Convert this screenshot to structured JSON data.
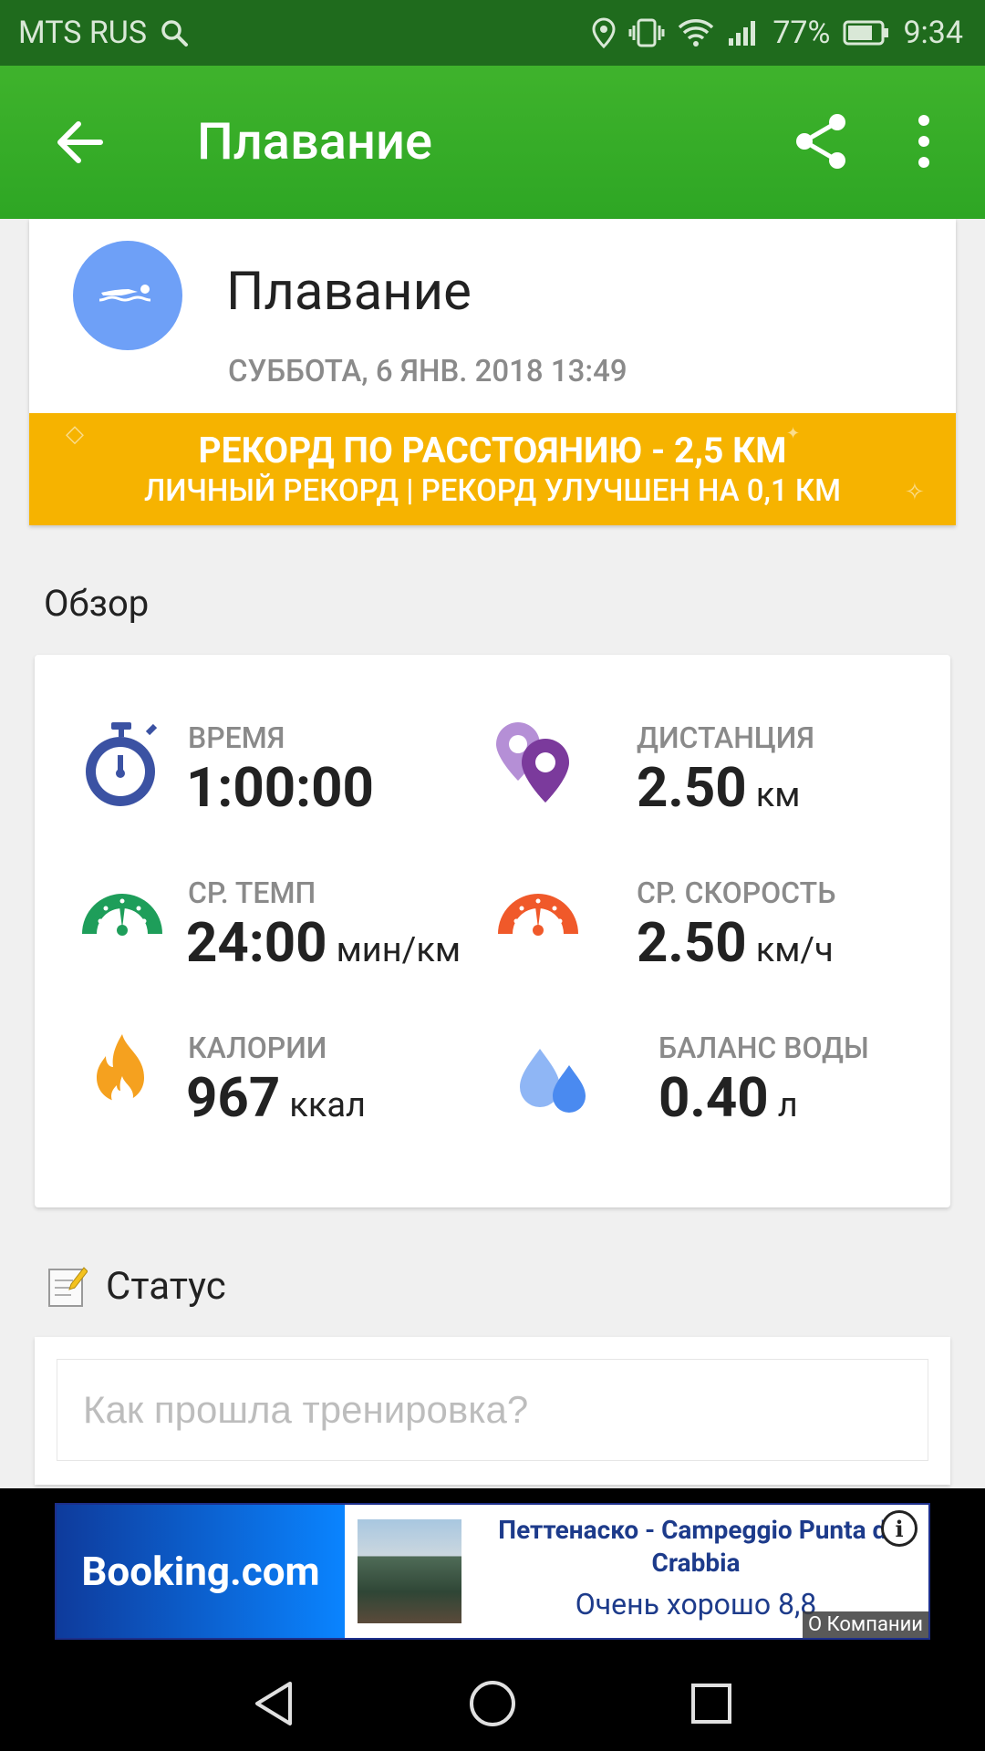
{
  "status_bar": {
    "carrier": "MTS RUS",
    "battery": "77%",
    "time": "9:34"
  },
  "app_bar": {
    "title": "Плавание"
  },
  "workout": {
    "title": "Плавание",
    "date": "СУББОТА, 6 ЯНВ. 2018 13:49",
    "record_line1": "РЕКОРД ПО РАССТОЯНИЮ  -  2,5 КМ",
    "record_line2": "ЛИЧНЫЙ РЕКОРД  |  РЕКОРД УЛУЧШЕН НА 0,1 КМ"
  },
  "overview": {
    "title": "Обзор",
    "metrics": [
      {
        "label": "ВРЕМЯ",
        "value": "1:00:00",
        "unit": "",
        "icon": "stopwatch-icon"
      },
      {
        "label": "ДИСТАНЦИЯ",
        "value": "2.50",
        "unit": "км",
        "icon": "location-pins-icon"
      },
      {
        "label": "СР. ТЕМП",
        "value": "24:00",
        "unit": "мин/км",
        "icon": "pace-gauge-icon"
      },
      {
        "label": "СР. СКОРОСТЬ",
        "value": "2.50",
        "unit": "км/ч",
        "icon": "speed-gauge-icon"
      },
      {
        "label": "КАЛОРИИ",
        "value": "967",
        "unit": "ккал",
        "icon": "flame-icon"
      },
      {
        "label": "БАЛАНС ВОДЫ",
        "value": "0.40",
        "unit": "л",
        "icon": "water-drops-icon"
      }
    ]
  },
  "status": {
    "title": "Статус",
    "placeholder": "Как прошла тренировка?"
  },
  "ad": {
    "brand": "Booking.com",
    "title": "Петтенаско - Campeggio Punta di Crabbia",
    "rating": "Очень хорошо 8,8",
    "company": "О Компании",
    "info": "i"
  },
  "colors": {
    "status_bar": "#1f6b1d",
    "app_bar": "#3aae28",
    "record_banner": "#f6b300",
    "avatar": "#6ea0f7"
  }
}
